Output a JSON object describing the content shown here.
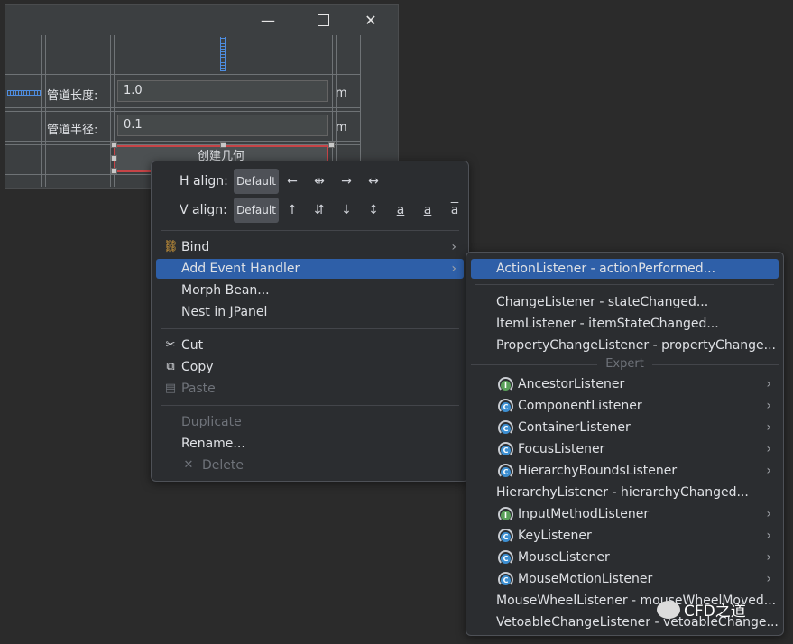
{
  "window": {
    "minimize_glyph": "—",
    "close_glyph": "✕"
  },
  "form": {
    "pipe_length_label": "管道长度:",
    "pipe_length_value": "1.0",
    "pipe_length_unit": "m",
    "pipe_radius_label": "管道半径:",
    "pipe_radius_value": "0.1",
    "pipe_radius_unit": "m",
    "create_button_label": "创建几何"
  },
  "context_menu": {
    "h_align_label": "H align:",
    "v_align_label": "V align:",
    "default_label": "Default",
    "h_align_icons": [
      "←",
      "⇹",
      "→",
      "↔"
    ],
    "v_align_icons": [
      "↑",
      "⇵",
      "↓",
      "↕",
      "a",
      "a",
      "a"
    ],
    "bind": "Bind",
    "add_event_handler": "Add Event Handler",
    "morph_bean": "Morph Bean...",
    "nest_in_jpanel": "Nest in JPanel",
    "cut": "Cut",
    "copy": "Copy",
    "paste": "Paste",
    "duplicate": "Duplicate",
    "rename": "Rename...",
    "delete": "Delete"
  },
  "submenu": {
    "action_listener": "ActionListener - actionPerformed...",
    "change_listener": "ChangeListener - stateChanged...",
    "item_listener": "ItemListener - itemStateChanged...",
    "property_change_listener": "PropertyChangeListener - propertyChange...",
    "expert_label": "Expert",
    "expert_items": [
      {
        "label": "AncestorListener",
        "letter": "I",
        "color": "#5aa05a"
      },
      {
        "label": "ComponentListener",
        "letter": "C",
        "color": "#3d8fd1"
      },
      {
        "label": "ContainerListener",
        "letter": "C",
        "color": "#3d8fd1"
      },
      {
        "label": "FocusListener",
        "letter": "C",
        "color": "#3d8fd1"
      },
      {
        "label": "HierarchyBoundsListener",
        "letter": "C",
        "color": "#3d8fd1"
      }
    ],
    "hierarchy_listener": "HierarchyListener - hierarchyChanged...",
    "expert_items2": [
      {
        "label": "InputMethodListener",
        "letter": "I",
        "color": "#5aa05a"
      },
      {
        "label": "KeyListener",
        "letter": "C",
        "color": "#3d8fd1"
      },
      {
        "label": "MouseListener",
        "letter": "C",
        "color": "#3d8fd1"
      },
      {
        "label": "MouseMotionListener",
        "letter": "C",
        "color": "#3d8fd1"
      }
    ],
    "mouse_wheel_listener": "MouseWheelListener - mouseWheelMoved...",
    "vetoable_change_listener": "VetoableChangeListener - vetoableChange..."
  },
  "watermark": "CFD之道",
  "colors": {
    "selection": "#2e5fa8",
    "menu_bg": "#2b2d30",
    "selected_border": "#c74447",
    "spring": "#4e8de0"
  }
}
